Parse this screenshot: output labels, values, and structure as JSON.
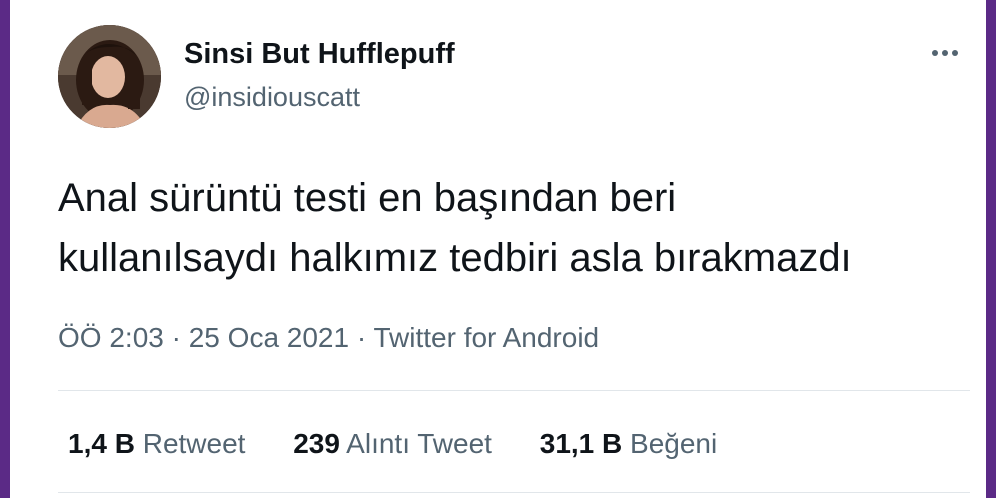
{
  "tweet": {
    "author": {
      "display_name": "Sinsi But Hufflepuff",
      "handle": "@insidiouscatt"
    },
    "text_lines": [
      "Anal sürüntü testi en başından beri",
      "kullanılsaydı halkımız tedbiri asla bırakmazdı"
    ],
    "time": "ÖÖ 2:03",
    "date": "25 Oca 2021",
    "separator": "·",
    "source": "Twitter for Android",
    "stats": [
      {
        "count": "1,4 B",
        "label": "Retweet"
      },
      {
        "count": "239",
        "label": "Alıntı Tweet"
      },
      {
        "count": "31,1 B",
        "label": "Beğeni"
      }
    ]
  },
  "icons": {
    "more": "more-horizontal-icon",
    "avatar": "profile-photo"
  },
  "colors": {
    "background_frame": "#5b2a86",
    "card": "#ffffff",
    "primary_text": "#0f1419",
    "secondary_text": "#536471",
    "divider": "#e1e6ea"
  }
}
